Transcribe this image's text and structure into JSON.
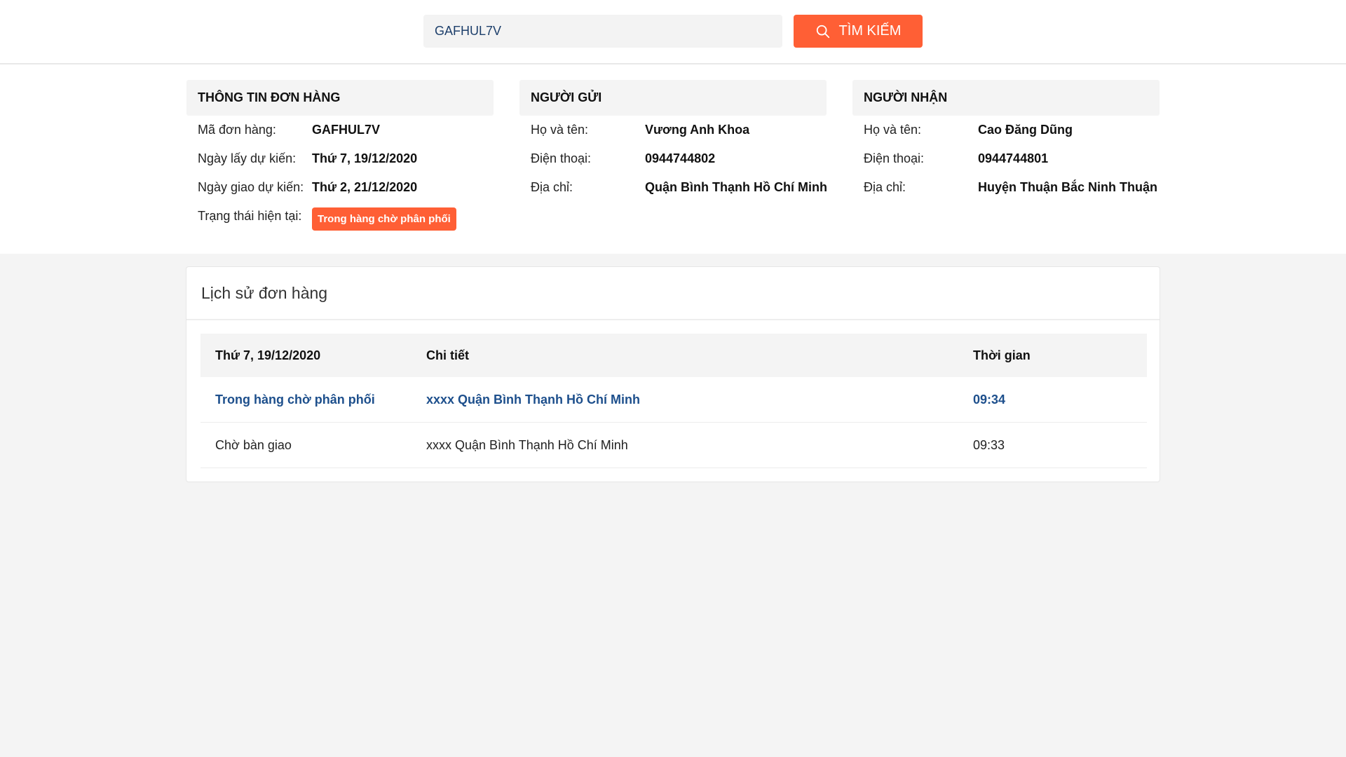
{
  "search": {
    "value": "GAFHUL7V",
    "button_label": "TÌM KIẾM"
  },
  "order_info": {
    "title": "THÔNG TIN ĐƠN HÀNG",
    "code_label": "Mã đơn hàng:",
    "code_value": "GAFHUL7V",
    "pickup_label": "Ngày lấy dự kiến:",
    "pickup_value": "Thứ 7, 19/12/2020",
    "delivery_label": "Ngày giao dự kiến:",
    "delivery_value": "Thứ 2, 21/12/2020",
    "status_label": "Trạng thái hiện tại:",
    "status_value": "Trong hàng chờ phân phối"
  },
  "sender": {
    "title": "NGƯỜI GỬI",
    "name_label": "Họ và tên:",
    "name_value": "Vương Anh Khoa",
    "phone_label": "Điện thoại:",
    "phone_value": "0944744802",
    "address_label": "Địa chỉ:",
    "address_value": "Quận Bình Thạnh Hồ Chí Minh"
  },
  "receiver": {
    "title": "NGƯỜI NHẬN",
    "name_label": "Họ và tên:",
    "name_value": "Cao Đăng Dũng",
    "phone_label": "Điện thoại:",
    "phone_value": "0944744801",
    "address_label": "Địa chỉ:",
    "address_value": "Huyện Thuận Bắc Ninh Thuận"
  },
  "history": {
    "title": "Lịch sử đơn hàng",
    "columns": [
      "Thứ 7, 19/12/2020",
      "Chi tiết",
      "Thời gian"
    ],
    "rows": [
      {
        "status": "Trong hàng chờ phân phối",
        "detail": "xxxx Quận Bình Thạnh Hồ Chí Minh",
        "time": "09:34"
      },
      {
        "status": "Chờ bàn giao",
        "detail": "xxxx Quận Bình Thạnh Hồ Chí Minh",
        "time": "09:33"
      }
    ]
  },
  "colors": {
    "accent": "#ff5f35",
    "link_blue": "#1d4f8c",
    "page_background": "#f4f4f4"
  },
  "icons": {
    "search_button_icon": "search-icon"
  }
}
